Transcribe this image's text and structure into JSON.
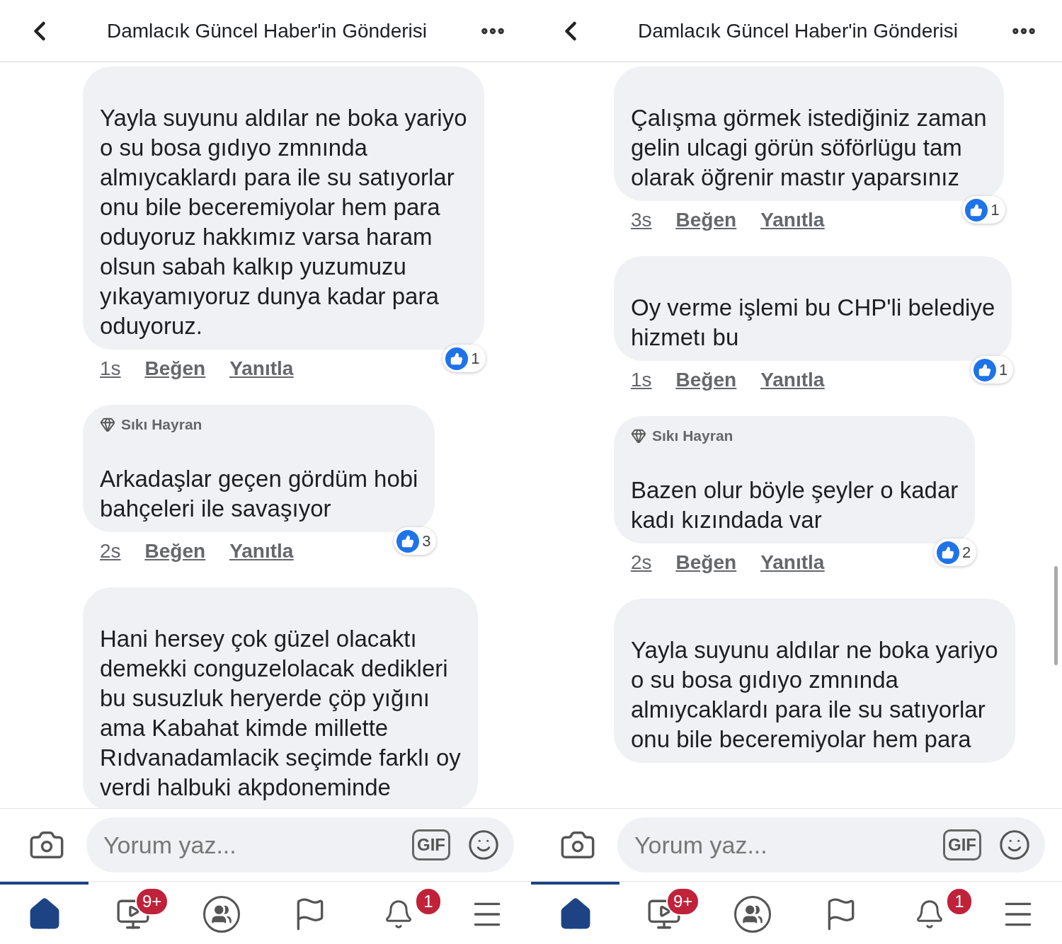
{
  "panels": [
    {
      "header": {
        "title": "Damlacık Güncel Haber'in Gönderisi"
      },
      "comments": [
        {
          "lines": [
            "Yayla suyunu aldılar ne boka yariyo",
            "o su bosa gıdıyo zmnında",
            "almıycaklardı para ile su satıyorlar",
            "onu bile beceremiyolar hem para",
            "oduyoruz hakkımız varsa haram",
            "olsun sabah kalkıp yuzumuzu",
            "yıkayamıyoruz dunya kadar para",
            "oduyoruz."
          ],
          "time": "1s",
          "like": "Beğen",
          "reply": "Yanıtla",
          "reactions": "1"
        },
        {
          "badge": "Sıkı Hayran",
          "lines": [
            "Arkadaşlar geçen gördüm hobi",
            "bahçeleri ile savaşıyor"
          ],
          "time": "2s",
          "like": "Beğen",
          "reply": "Yanıtla",
          "reactions": "3"
        },
        {
          "lines": [
            "Hani hersey çok güzel olacaktı",
            "demekki conguzelolacak dedikleri",
            "bu susuzluk heryerde çöp yığını",
            "ama Kabahat kimde millette",
            "Rıdvanadamlacik seçimde farklı oy",
            "verdi halbuki akpdoneminde"
          ]
        }
      ],
      "composer": {
        "placeholder": "Yorum yaz...",
        "gif": "GIF"
      },
      "tabs": [
        {
          "kind": "home",
          "selected": true
        },
        {
          "kind": "video",
          "selected": false,
          "badge": "9+"
        },
        {
          "kind": "groups",
          "selected": false
        },
        {
          "kind": "pages",
          "selected": false
        },
        {
          "kind": "notifications",
          "selected": false,
          "badge": "1"
        },
        {
          "kind": "menu",
          "selected": false
        }
      ]
    },
    {
      "header": {
        "title": "Damlacık Güncel Haber'in Gönderisi"
      },
      "comments": [
        {
          "lines": [
            "Çalışma görmek istediğiniz zaman",
            "gelin ulcagi görün söförlügu tam",
            "olarak öğrenir mastır yaparsınız"
          ],
          "time": "3s",
          "like": "Beğen",
          "reply": "Yanıtla",
          "reactions": "1"
        },
        {
          "lines": [
            "Oy verme işlemi bu CHP'li belediye",
            "hizmetı bu"
          ],
          "time": "1s",
          "like": "Beğen",
          "reply": "Yanıtla",
          "reactions": "1"
        },
        {
          "badge": "Sıkı Hayran",
          "lines": [
            "Bazen olur böyle şeyler o kadar",
            "kadı kızındada var"
          ],
          "time": "2s",
          "like": "Beğen",
          "reply": "Yanıtla",
          "reactions": "2"
        },
        {
          "lines": [
            "Yayla suyunu aldılar ne boka yariyo",
            "o su bosa gıdıyo zmnında",
            "almıycaklardı para ile su satıyorlar",
            "onu bile beceremiyolar hem para"
          ]
        }
      ],
      "composer": {
        "placeholder": "Yorum yaz...",
        "gif": "GIF"
      },
      "tabs": [
        {
          "kind": "home",
          "selected": true
        },
        {
          "kind": "video",
          "selected": false,
          "badge": "9+"
        },
        {
          "kind": "groups",
          "selected": false
        },
        {
          "kind": "pages",
          "selected": false
        },
        {
          "kind": "notifications",
          "selected": false,
          "badge": "1"
        },
        {
          "kind": "menu",
          "selected": false
        }
      ]
    }
  ]
}
